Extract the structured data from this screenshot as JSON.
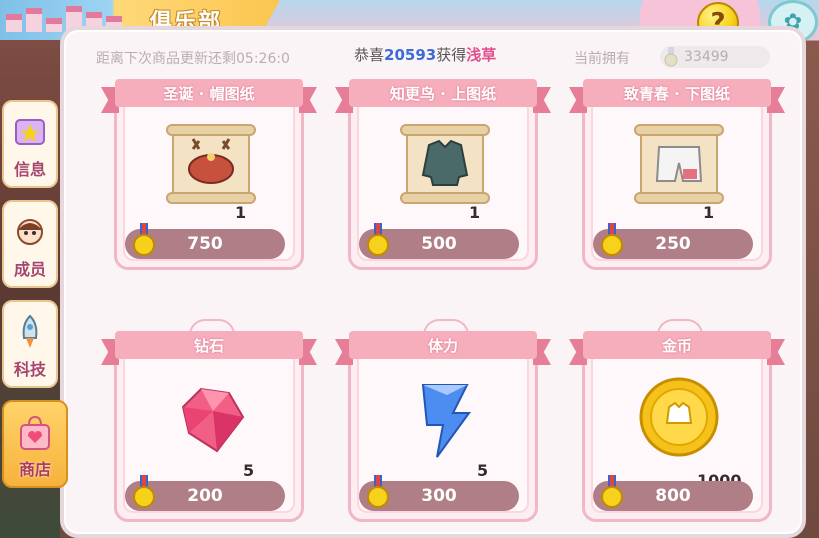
{
  "header": {
    "title": "俱乐部",
    "help_label": "?",
    "close_label": "✿"
  },
  "info": {
    "refresh_text": "距离下次商品更新还剩05:26:0",
    "congrats_prefix": "恭喜",
    "congrats_user": "20593",
    "congrats_mid": "获得",
    "congrats_item": "浅草",
    "own_label": "当前拥有",
    "own_value": "33499"
  },
  "sidebar": {
    "items": [
      {
        "label": "信息",
        "icon": "star-card-icon"
      },
      {
        "label": "成员",
        "icon": "girl-avatar-icon"
      },
      {
        "label": "科技",
        "icon": "rocket-icon"
      },
      {
        "label": "商店",
        "icon": "shopping-bag-icon",
        "active": true
      }
    ]
  },
  "shop": {
    "items": [
      {
        "name": "圣诞 · 帽图纸",
        "qty": "1",
        "price": "750",
        "icon": "scroll-hat-icon"
      },
      {
        "name": "知更鸟 · 上图纸",
        "qty": "1",
        "price": "500",
        "icon": "scroll-jacket-icon"
      },
      {
        "name": "致青春 · 下图纸",
        "qty": "1",
        "price": "250",
        "icon": "scroll-shorts-icon"
      },
      {
        "name": "钻石",
        "qty": "5",
        "price": "200",
        "icon": "diamond-icon"
      },
      {
        "name": "体力",
        "qty": "5",
        "price": "300",
        "icon": "energy-crystal-icon"
      },
      {
        "name": "金币",
        "qty": "1000",
        "price": "800",
        "icon": "gold-coin-icon"
      }
    ]
  },
  "colors": {
    "accent_pink": "#f6aebd",
    "price_bar": "#b07e86",
    "gold": "#f7d21d"
  }
}
